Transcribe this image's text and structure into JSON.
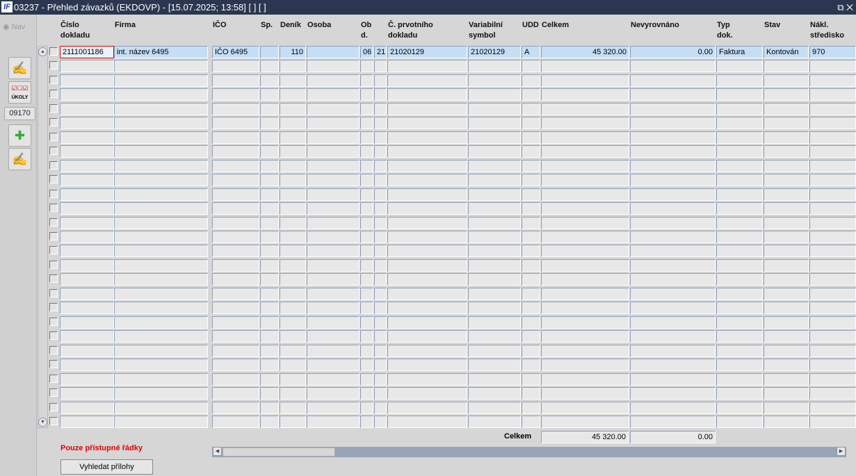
{
  "window": {
    "title": "03237 - Přehled závazků (EKDOVP) - [15.07.2025; 13:58]  [ ]  [ ]",
    "logo": "IF",
    "controls": "⧉ ✕"
  },
  "nav": {
    "label": "Nav"
  },
  "toolbar": {
    "code": "09170",
    "buttons": [
      {
        "icon": "edit-document-icon"
      },
      {
        "icon": "tasks-icon",
        "label": "ÚKOLY"
      },
      {
        "icon": "new-document-icon"
      },
      {
        "icon": "edit-document-icon"
      }
    ]
  },
  "columns": [
    {
      "key": "cislo",
      "label": "Číslo\ndokladu"
    },
    {
      "key": "firma",
      "label": "Firma"
    },
    {
      "key": "ico",
      "label": "IČO"
    },
    {
      "key": "sp",
      "label": "Sp."
    },
    {
      "key": "denik",
      "label": "Deník"
    },
    {
      "key": "osoba",
      "label": "Osoba"
    },
    {
      "key": "ob",
      "label": "Ob\nd."
    },
    {
      "key": "d",
      "label": ""
    },
    {
      "key": "cprv",
      "label": "Č. prvotního\ndokladu"
    },
    {
      "key": "vs",
      "label": "Variabilní\nsymbol"
    },
    {
      "key": "udd",
      "label": "UDD"
    },
    {
      "key": "celkem",
      "label": "Celkem"
    },
    {
      "key": "nevyr",
      "label": "Nevyrovnáno"
    },
    {
      "key": "typ",
      "label": "Typ\ndok."
    },
    {
      "key": "stav",
      "label": "Stav"
    },
    {
      "key": "nakl",
      "label": "Nákl.\nstředisko"
    }
  ],
  "rows": [
    {
      "cislo": "2111001186",
      "firma": "int. název 6495",
      "ico": "IČO 6495",
      "sp": "",
      "denik": "110",
      "osoba": "",
      "ob": "06",
      "d": "21",
      "cprv": "21020129",
      "vs": "21020129",
      "udd": "A",
      "celkem": "45 320.00",
      "nevyr": "0.00",
      "typ": "Faktura",
      "stav": "Kontován",
      "nakl": "970"
    }
  ],
  "empty_rows": 26,
  "totals": {
    "label": "Celkem",
    "celkem": "45 320.00",
    "nevyrovnano": "0.00"
  },
  "footer": {
    "note": "Pouze přístupné řádky",
    "search_attachments": "Vyhledat přílohy"
  }
}
